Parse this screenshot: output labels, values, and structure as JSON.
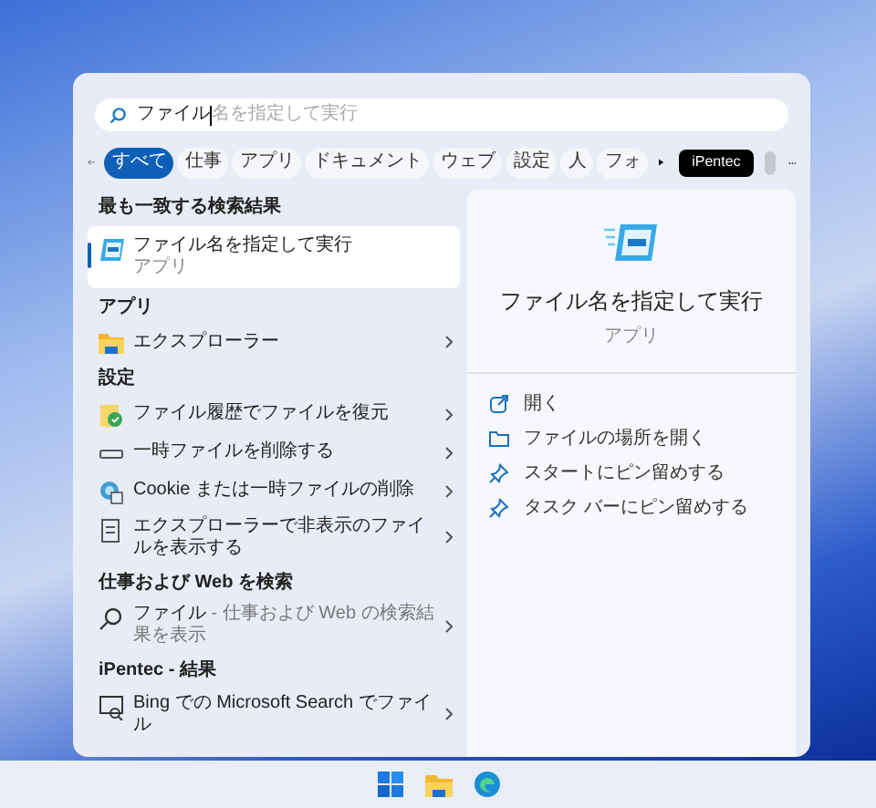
{
  "search": {
    "value": "ファイル",
    "suggestion": "名を指定して実行"
  },
  "filters": [
    {
      "label": "すべて",
      "selected": true
    },
    {
      "label": "仕事",
      "selected": false
    },
    {
      "label": "アプリ",
      "selected": false
    },
    {
      "label": "ドキュメント",
      "selected": false
    },
    {
      "label": "ウェブ",
      "selected": false
    },
    {
      "label": "設定",
      "selected": false
    },
    {
      "label": "人",
      "selected": false
    },
    {
      "label": "フォ",
      "selected": false
    }
  ],
  "account": {
    "label": "iPentec"
  },
  "sections": [
    {
      "title": "最も一致する検索結果",
      "items": [
        {
          "kind": "best",
          "title": "ファイル名を指定して実行",
          "subtitle": "アプリ",
          "selected": true
        }
      ]
    },
    {
      "title": "アプリ",
      "items": [
        {
          "kind": "item",
          "title": "エクスプローラー",
          "selected": false
        }
      ]
    },
    {
      "title": "設定",
      "items": [
        {
          "kind": "item",
          "title": "ファイル履歴でファイルを復元",
          "selected": false
        },
        {
          "kind": "item",
          "title": "一時ファイルを削除する",
          "selected": false
        },
        {
          "kind": "item",
          "title": "Cookie または一時ファイルの削除",
          "selected": false
        },
        {
          "kind": "item",
          "title": "エクスプローラーで非表示のファイルを表示する",
          "selected": false
        }
      ]
    },
    {
      "title": "仕事および Web を検索",
      "items": [
        {
          "kind": "item",
          "title": "ファイル",
          "detail": " - 仕事および Web の検索結果を表示",
          "selected": false
        }
      ]
    },
    {
      "title": "iPentec - 結果",
      "items": [
        {
          "kind": "item",
          "title": "Bing での Microsoft Search でファイル",
          "selected": false
        }
      ]
    }
  ],
  "preview": {
    "title": "ファイル名を指定して実行",
    "subtitle": "アプリ",
    "actions": [
      "開く",
      "ファイルの場所を開く",
      "スタートにピン留めする",
      "タスク バーにピン留めする"
    ]
  }
}
